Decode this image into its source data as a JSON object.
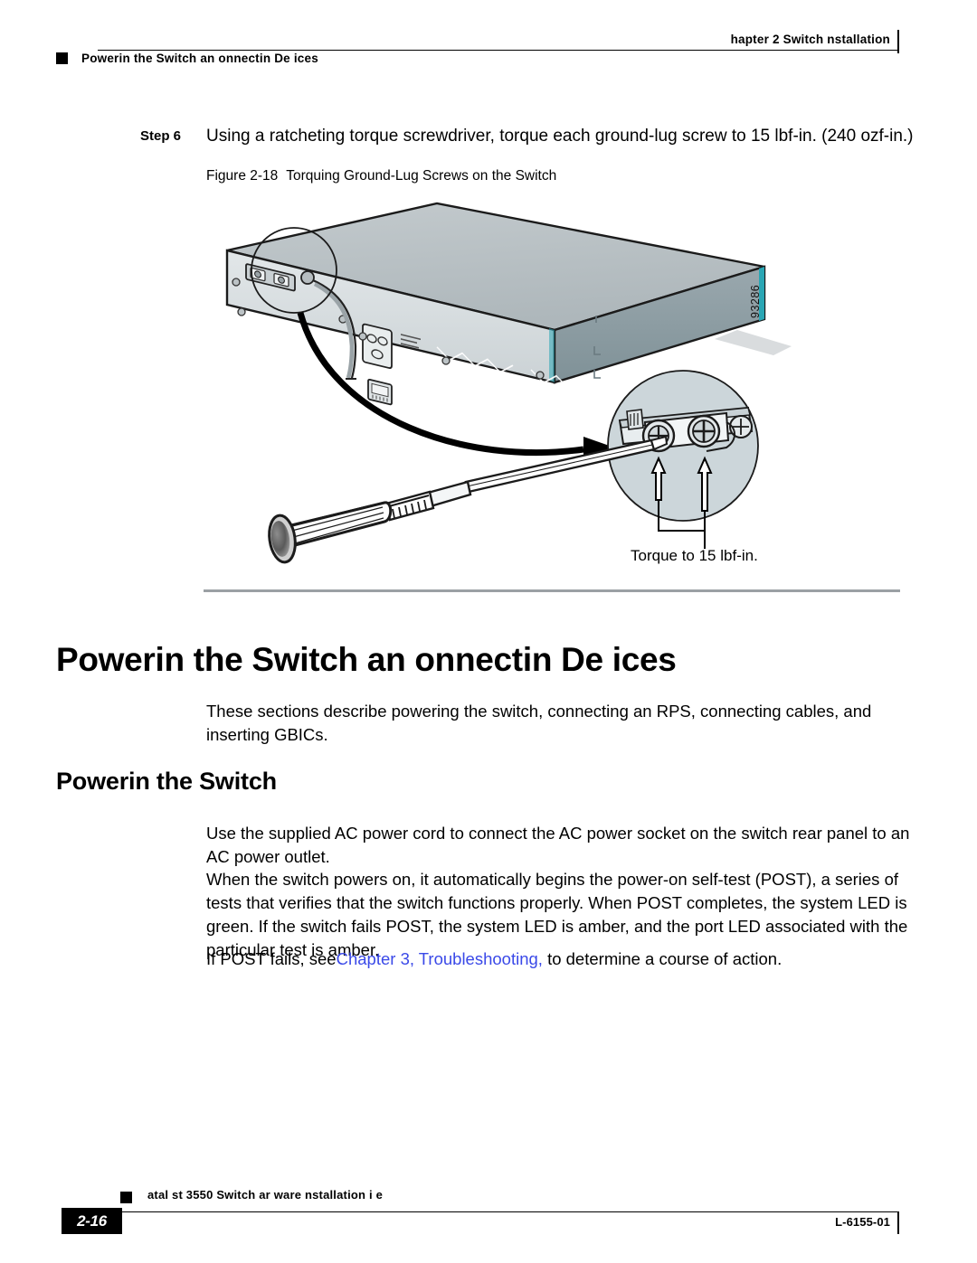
{
  "header": {
    "chapter": "hapter 2    Switch  nstallation",
    "running_head": "Powerin  the Switch an    onnectin  De ices",
    "bullet_icon": "square-bullet-icon"
  },
  "step": {
    "label": "Step 6",
    "text": "Using a ratcheting torque screwdriver, torque each ground-lug screw to 15 lbf-in. (240 ozf-in.)"
  },
  "figure": {
    "number": "Figure 2-18",
    "title": "Torquing Ground-Lug Screws on the Switch",
    "artwork_id": "93286",
    "callout_label": "Torque to 15 lbf-in.",
    "parts": {
      "switch_chassis": "catalyst-switch-rear-view",
      "ground_lug": "ground-lug-with-two-screws",
      "ground_wire": "ground-wire",
      "ac_socket": "ac-power-socket",
      "rps_connector": "rps-connector",
      "screwdriver": "ratcheting-torque-screwdriver",
      "magnifier": "callout-detail-circle",
      "arrow": "direction-arrow"
    },
    "colors": {
      "chassis_top": "#b9c0c4",
      "chassis_front": "#d8dde0",
      "chassis_side": "#8d9ba1",
      "accent_teal": "#2aa6b4",
      "detail_fill": "#ccd6da"
    }
  },
  "headings": {
    "h1": "Powerin  the Switch an    onnectin  De ices",
    "h2": "Powerin  the Switch"
  },
  "body": {
    "intro": "These sections describe powering the switch, connecting an RPS, connecting cables, and inserting GBICs.",
    "use_cord": "Use the supplied AC power cord to connect the AC power socket on the switch rear panel to an AC power outlet.",
    "post": "When the switch powers on, it automatically begins the power-on self-test (POST), a series of tests that verifies that the switch functions properly. When POST completes, the system LED is green. If the switch fails POST, the system LED is amber, and the port LED associated with the particular test is amber.",
    "post_fail_before": "If POST fails, see",
    "post_fail_link": "Chapter 3, Troubleshooting,",
    "post_fail_after": " to determine a course of action.",
    "link_color": "#3a49e8"
  },
  "footer": {
    "guide_title": "atal st 3550 Switch  ar ware  nstallation   i e",
    "page_number": "2-16",
    "doc_id": "L-6155-01",
    "bullet_icon": "square-bullet-icon"
  }
}
